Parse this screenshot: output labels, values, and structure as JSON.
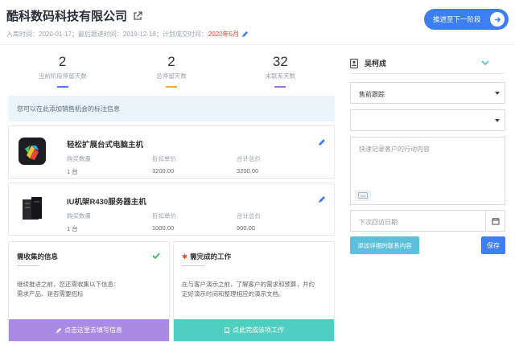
{
  "header": {
    "company_name": "酷科数码科技有限公司",
    "entry_time": "入库时间：2020-01-17；",
    "last_follow": "最后跟进时间：2019-12-18；",
    "plan_label": "计划成交时间：",
    "plan_value": "2020年5月",
    "advance_button": "推进至下一阶段"
  },
  "stats": [
    {
      "value": "2",
      "label": "当前阶段停留天数",
      "color": "#4a7cf0"
    },
    {
      "value": "2",
      "label": "总停留天数",
      "color": "#f0a93b"
    },
    {
      "value": "32",
      "label": "未联系天数",
      "color": "#a36ddc"
    }
  ],
  "info_tip": "您可以在此添加销售机会的标注信息",
  "products": [
    {
      "name": "轻松扩展台式电脑主机",
      "qty_label": "购买数量",
      "qty": "1 台",
      "price_label": "折扣单价",
      "price": "3200.00",
      "total_label": "合计总价",
      "total": "3200.00"
    },
    {
      "name": "IU机架R430服务器主机",
      "qty_label": "购买数量",
      "qty": "1 台",
      "price_label": "折扣单价",
      "price": "1000.00",
      "total_label": "合计总价",
      "total": "900.00"
    }
  ],
  "cards": {
    "collect": {
      "title": "需收集的信息",
      "line1": "继续推进之前，您还需收集以下信息：",
      "line2": "需求产品、是否需要招标",
      "button": "点击这里去填写信息",
      "color": "#a98be3"
    },
    "todo": {
      "star": "✱",
      "title": "需完成的工作",
      "line1": "在与客户演示之前，了解客户的需求和预算，并约",
      "line2": "定好演示时间和整理相应的演示文档。",
      "button": "点此完成该项工作",
      "color": "#4fcfbf"
    }
  },
  "side": {
    "person": "吴柯成",
    "stage_select": "售前跟踪",
    "second_select": "",
    "action_placeholder": "快速记录客户的行动内容",
    "date_placeholder": "下次回访日期",
    "detail_button": "添加详细的联系内容",
    "save_button": "保存"
  }
}
